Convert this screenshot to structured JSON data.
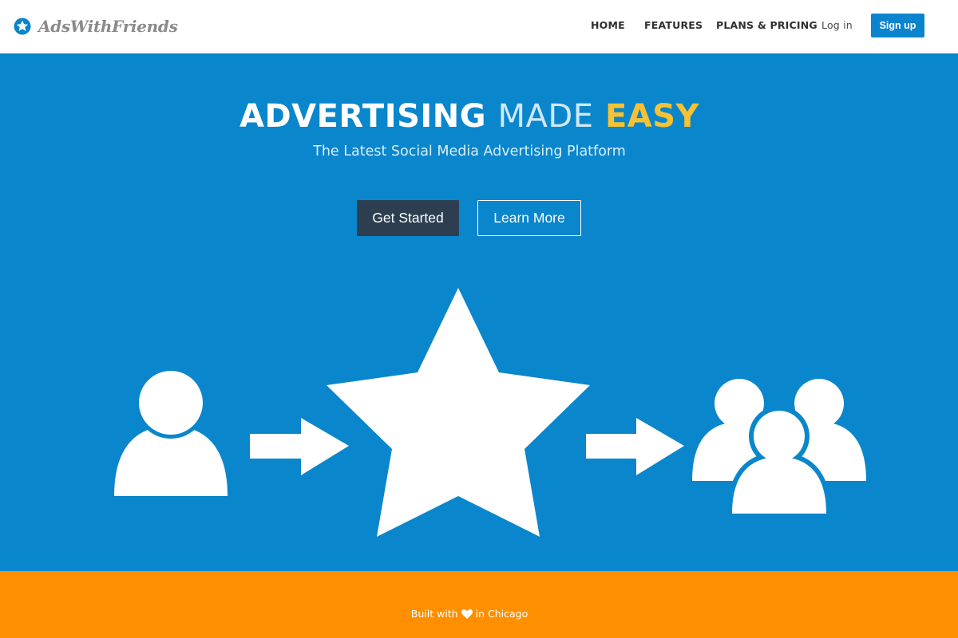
{
  "brand": {
    "name": "AdsWithFriends",
    "icon": "star-badge-icon",
    "color": "#8a8a8a",
    "accent": "#0a84cd"
  },
  "nav": {
    "items": [
      "HOME",
      "FEATURES",
      "PLANS & PRICING"
    ],
    "login": "Log in",
    "signup": "Sign up"
  },
  "hero": {
    "headline": {
      "word1": "ADVERTISING",
      "word2": "MADE",
      "word3": "EASY"
    },
    "subtitle": "The Latest Social Media Advertising Platform",
    "primary_button": "Get Started",
    "secondary_button": "Learn More",
    "background": "#0a86cc",
    "highlight_color": "#f6c233",
    "illustration_icons": [
      "user-icon",
      "arrow-right-icon",
      "star-icon",
      "arrow-right-icon",
      "user-group-icon"
    ]
  },
  "footer": {
    "text_before": "Built with",
    "icon": "heart-icon",
    "text_after": "in Chicago",
    "background": "#fe9000"
  }
}
